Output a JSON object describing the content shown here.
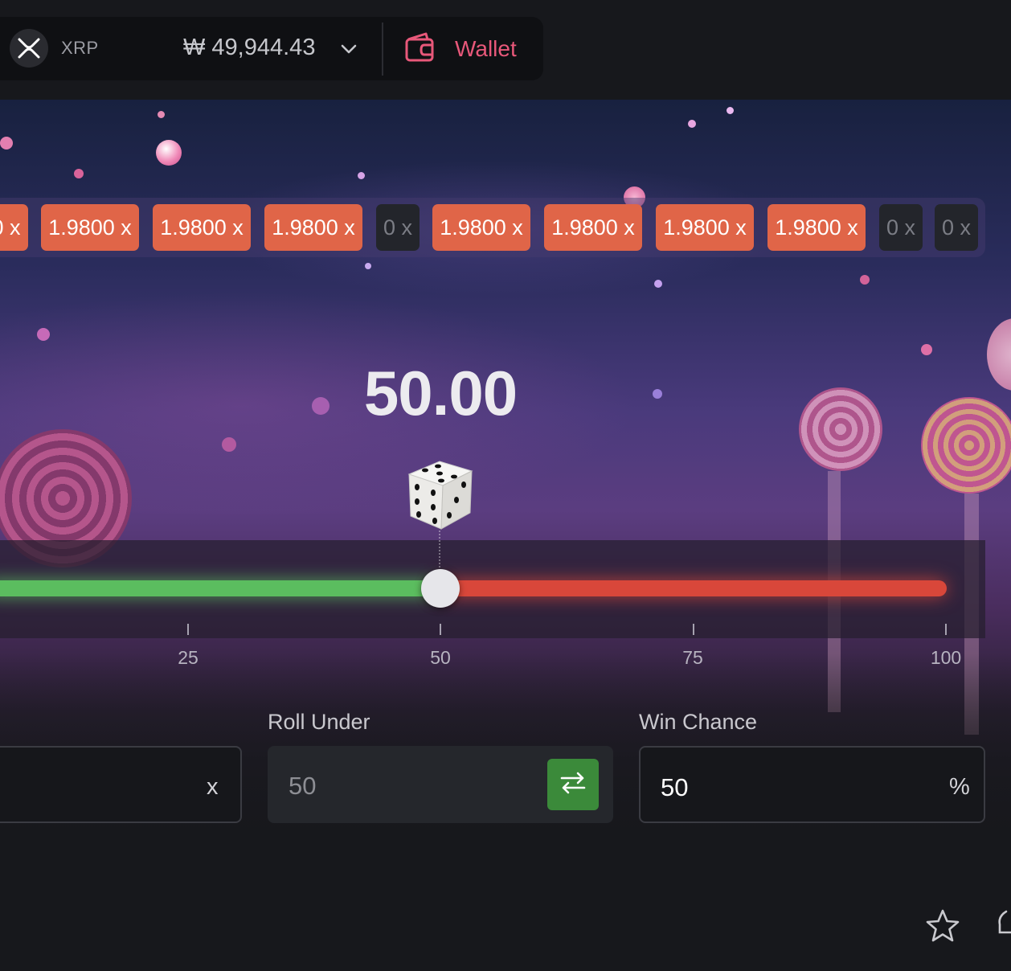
{
  "header": {
    "coin": "XRP",
    "balance": "₩ 49,944.43",
    "wallet_label": "Wallet"
  },
  "history": [
    {
      "label": "0 x",
      "win": true
    },
    {
      "label": "1.9800 x",
      "win": true
    },
    {
      "label": "1.9800 x",
      "win": true
    },
    {
      "label": "1.9800 x",
      "win": true
    },
    {
      "label": "0 x",
      "win": false
    },
    {
      "label": "1.9800 x",
      "win": true
    },
    {
      "label": "1.9800 x",
      "win": true
    },
    {
      "label": "1.9800 x",
      "win": true
    },
    {
      "label": "1.9800 x",
      "win": true
    },
    {
      "label": "0 x",
      "win": false
    },
    {
      "label": "0 x",
      "win": false
    }
  ],
  "game": {
    "result": "50.00",
    "slider_value": 50,
    "scale": [
      "25",
      "50",
      "75",
      "100"
    ]
  },
  "controls": {
    "multiplier_suffix": "x",
    "roll_under_label": "Roll Under",
    "roll_under_value": "50",
    "win_chance_label": "Win Chance",
    "win_chance_value": "50",
    "win_chance_suffix": "%"
  },
  "colors": {
    "win_chip": "#e06548",
    "loss_chip": "#23252b",
    "under_bar": "#5bbd5f",
    "over_bar": "#d9473a",
    "wallet_accent": "#e8587a",
    "swap_button": "#3b8a3a"
  },
  "icons": [
    "xrp-icon",
    "chevron-down-icon",
    "wallet-icon",
    "dice-icon",
    "swap-icon",
    "star-icon"
  ]
}
